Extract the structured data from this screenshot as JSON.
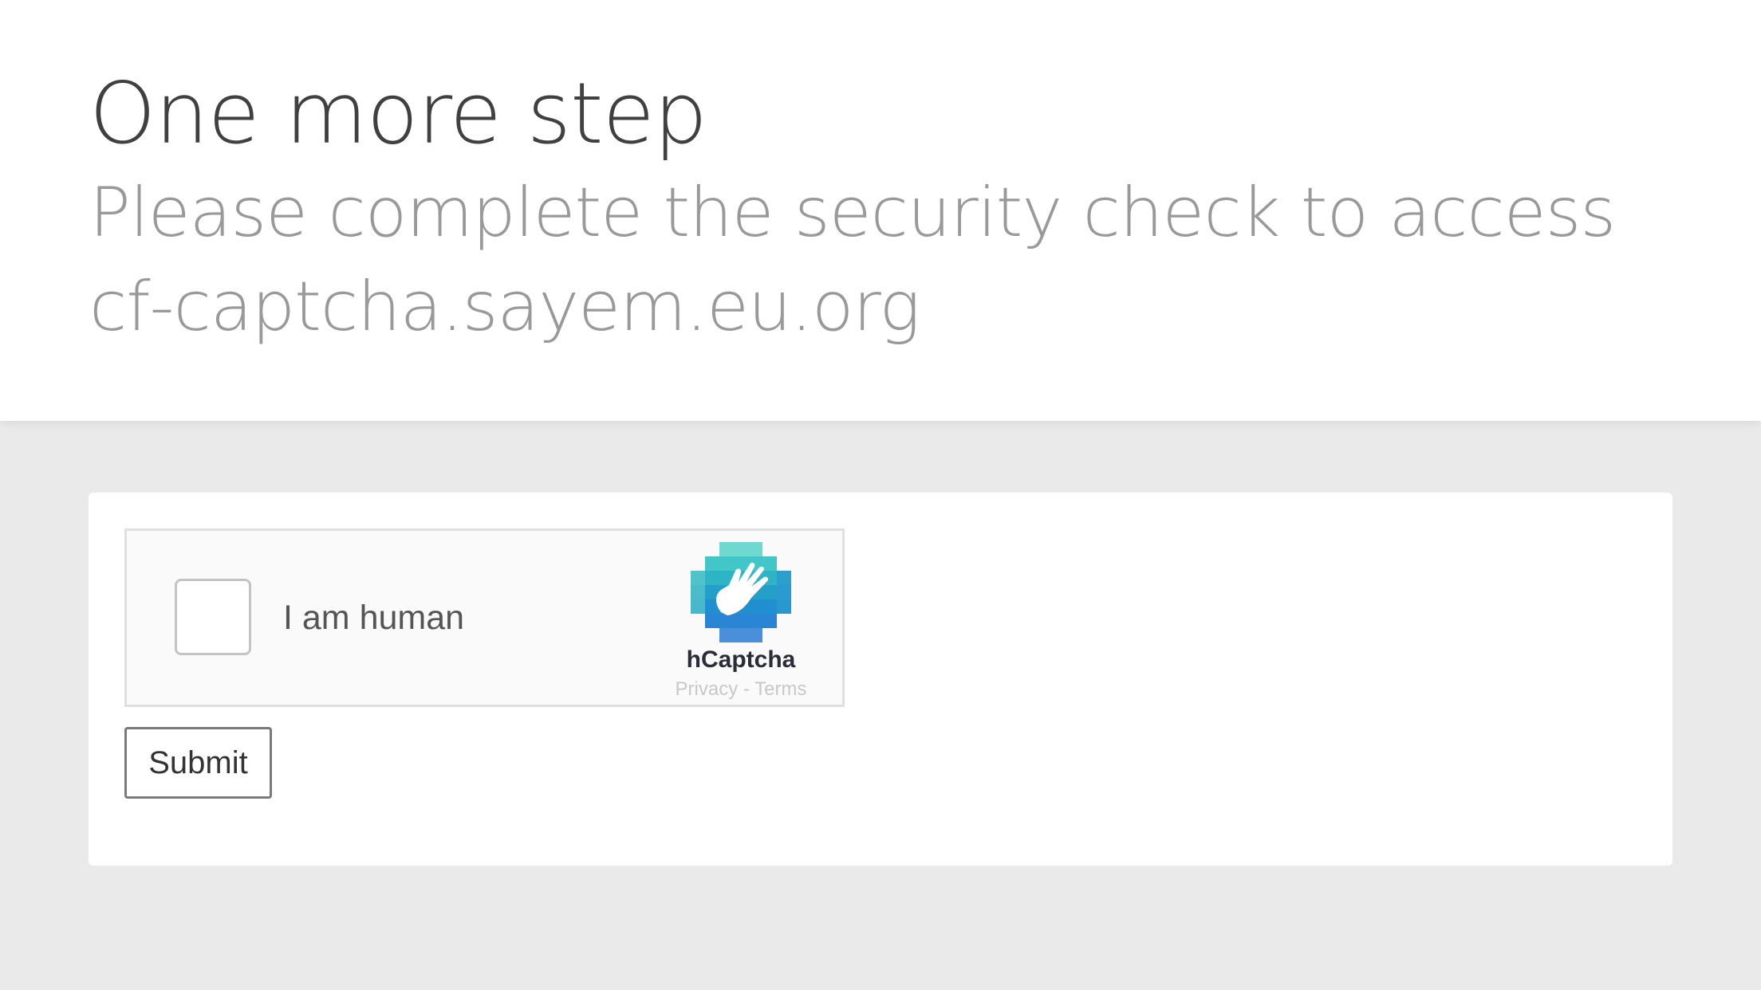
{
  "header": {
    "title": "One more step",
    "subtitle": "Please complete the security check to access cf-captcha.sayem.eu.org"
  },
  "captcha": {
    "checkbox_label": "I am human",
    "brand": "hCaptcha",
    "privacy_link": "Privacy",
    "separator": " - ",
    "terms_link": "Terms",
    "logo_icon": "hcaptcha-hand-icon",
    "colors": {
      "logo_light": "#4fd1c5",
      "logo_mid": "#2bb3c9",
      "logo_dark": "#1a7fd0"
    }
  },
  "form": {
    "submit_label": "Submit"
  }
}
